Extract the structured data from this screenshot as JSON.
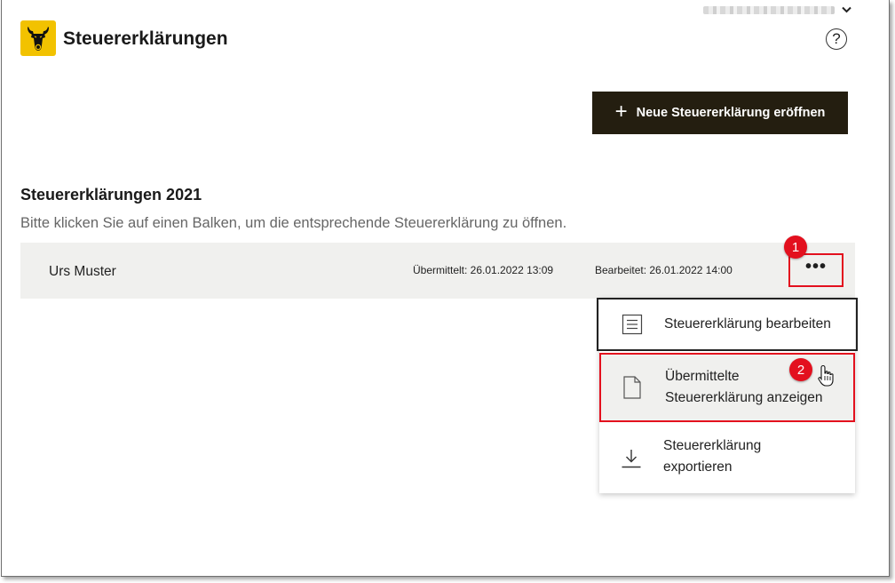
{
  "app": {
    "title": "Steuererklärungen"
  },
  "header": {
    "user_menu_icon": "chevron-down-icon",
    "help_label": "?"
  },
  "actions": {
    "new_button_label": "Neue Steuererklärung eröffnen"
  },
  "section": {
    "title": "Steuererklärungen 2021",
    "subtitle": "Bitte klicken Sie auf einen Balken, um die entsprechende Steuererklärung zu öffnen."
  },
  "rows": [
    {
      "name": "Urs Muster",
      "submitted": "Übermittelt: 26.01.2022 13:09",
      "edited": "Bearbeitet: 26.01.2022 14:00",
      "more_label": "•••"
    }
  ],
  "menu": {
    "items": [
      {
        "label": "Steuererklärung bearbeiten",
        "icon": "document-lines-icon"
      },
      {
        "label_line1": "Übermittelte",
        "label_line2": "Steuererklärung anzeigen",
        "icon": "document-icon"
      },
      {
        "label_line1": "Steuererklärung",
        "label_line2": "exportieren",
        "icon": "download-icon"
      }
    ]
  },
  "badges": {
    "step1": "1",
    "step2": "2"
  },
  "colors": {
    "accent_dark": "#241e10",
    "highlight_red": "#e3101e",
    "logo_yellow": "#f2c200",
    "row_bg": "#f0f0ee"
  }
}
